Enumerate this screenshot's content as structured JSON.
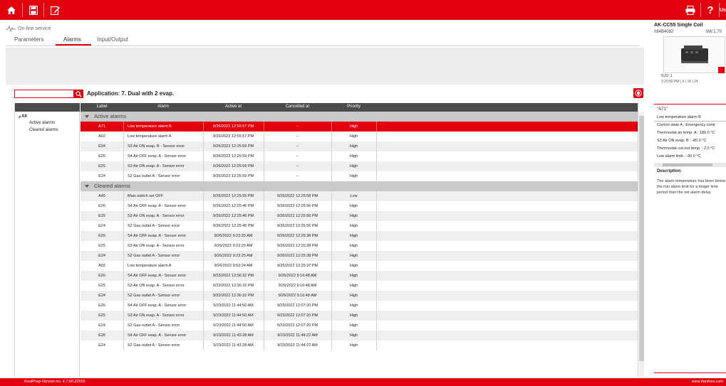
{
  "theme": {
    "accent": "#e2000f",
    "header_bg": "#4b4b4b",
    "group_bg": "#c9c9c9",
    "row_alt": "#efefef"
  },
  "toolbar": {
    "left_icons": [
      "home-icon",
      "save-icon",
      "edit-icon"
    ],
    "right_icons": [
      "print-icon",
      "help-icon"
    ],
    "user_label": "Us"
  },
  "service": {
    "label": "On-line service"
  },
  "tabs": [
    {
      "label": "Parameters",
      "active": false
    },
    {
      "label": "Alarms",
      "active": true
    },
    {
      "label": "Input/Output",
      "active": false
    }
  ],
  "search": {
    "value": "",
    "placeholder": ""
  },
  "application": {
    "label": "Application: 7. Dual with 2 evap."
  },
  "tree": {
    "root": "All",
    "children": [
      "Active alarms",
      "Cleared alarms"
    ]
  },
  "grid": {
    "columns": [
      "Label",
      "Alarm",
      "Active at",
      "Cancelled at",
      "Priority"
    ],
    "groups": [
      {
        "label": "Active alarms",
        "rows": [
          {
            "label": "A71",
            "alarm": "Low temperature alarm B",
            "active_at": "9/26/2022 12:55:57 PM",
            "cancelled_at": "--",
            "priority": "High",
            "selected": true
          },
          {
            "label": "A02",
            "alarm": "Low temperature alarm A",
            "active_at": "9/26/2022 12:55:57 PM",
            "cancelled_at": "--",
            "priority": "High",
            "selected": false
          },
          {
            "label": "E34",
            "alarm": "S3 Air ON evap. B - Sensor error",
            "active_at": "9/26/2022 12:25:59 PM",
            "cancelled_at": "--",
            "priority": "High",
            "selected": false
          },
          {
            "label": "E26",
            "alarm": "S4 Air OFF evap. A - Sensor error",
            "active_at": "9/26/2022 12:25:59 PM",
            "cancelled_at": "--",
            "priority": "High",
            "selected": false
          },
          {
            "label": "E25",
            "alarm": "S3 Air ON evap. A - Sensor error",
            "active_at": "9/26/2022 12:25:59 PM",
            "cancelled_at": "--",
            "priority": "High",
            "selected": false
          },
          {
            "label": "E24",
            "alarm": "S2 Gas outlet A - Sensor error",
            "active_at": "9/26/2022 12:25:59 PM",
            "cancelled_at": "--",
            "priority": "High",
            "selected": false
          }
        ]
      },
      {
        "label": "Cleared alarms",
        "rows": [
          {
            "label": "A45",
            "alarm": "Main switch set OFF",
            "active_at": "9/26/2022 12:25:55 PM",
            "cancelled_at": "9/26/2022 12:25:58 PM",
            "priority": "Low",
            "selected": false
          },
          {
            "label": "E26",
            "alarm": "S4 Air OFF evap. A - Sensor error",
            "active_at": "9/26/2022 12:25:46 PM",
            "cancelled_at": "9/26/2022 12:25:56 PM",
            "priority": "High",
            "selected": false
          },
          {
            "label": "E25",
            "alarm": "S3 Air ON evap. A - Sensor error",
            "active_at": "9/26/2022 12:25:46 PM",
            "cancelled_at": "9/26/2022 12:25:56 PM",
            "priority": "High",
            "selected": false
          },
          {
            "label": "E24",
            "alarm": "S2 Gas outlet A - Sensor error",
            "active_at": "9/26/2022 12:25:46 PM",
            "cancelled_at": "9/26/2022 12:25:56 PM",
            "priority": "High",
            "selected": false
          },
          {
            "label": "E26",
            "alarm": "S4 Air OFF evap. A - Sensor error",
            "active_at": "9/26/2022 9:23:25 AM",
            "cancelled_at": "9/26/2022 12:25:38 PM",
            "priority": "High",
            "selected": false
          },
          {
            "label": "E25",
            "alarm": "S3 Air ON evap. A - Sensor error",
            "active_at": "9/26/2022 9:23:25 AM",
            "cancelled_at": "9/26/2022 12:25:38 PM",
            "priority": "High",
            "selected": false
          },
          {
            "label": "E24",
            "alarm": "S2 Gas outlet A - Sensor error",
            "active_at": "9/26/2022 9:23:25 AM",
            "cancelled_at": "9/26/2022 12:25:38 PM",
            "priority": "High",
            "selected": false
          },
          {
            "label": "A02",
            "alarm": "Low temperature alarm A",
            "active_at": "9/26/2022 9:53:24 AM",
            "cancelled_at": "9/26/2022 12:25:37 PM",
            "priority": "High",
            "selected": false
          },
          {
            "label": "E26",
            "alarm": "S4 Air OFF evap. A - Sensor error",
            "active_at": "9/23/2022 12:36:32 PM",
            "cancelled_at": "9/26/2022 9:16:48 AM",
            "priority": "High",
            "selected": false
          },
          {
            "label": "E25",
            "alarm": "S3 Air ON evap. A - Sensor error",
            "active_at": "9/23/2022 12:36:32 PM",
            "cancelled_at": "9/26/2022 9:16:48 AM",
            "priority": "High",
            "selected": false
          },
          {
            "label": "E24",
            "alarm": "S2 Gas outlet A - Sensor error",
            "active_at": "9/23/2022 12:36:32 PM",
            "cancelled_at": "9/26/2022 9:16:48 AM",
            "priority": "High",
            "selected": false
          },
          {
            "label": "E26",
            "alarm": "S4 Air OFF evap. A - Sensor error",
            "active_at": "9/23/2022 11:44:50 AM",
            "cancelled_at": "9/23/2022 12:07:20 PM",
            "priority": "High",
            "selected": false
          },
          {
            "label": "E25",
            "alarm": "S3 Air ON evap. A - Sensor error",
            "active_at": "9/23/2022 11:44:50 AM",
            "cancelled_at": "9/23/2022 12:07:20 PM",
            "priority": "High",
            "selected": false
          },
          {
            "label": "E24",
            "alarm": "S2 Gas outlet A - Sensor error",
            "active_at": "9/23/2022 11:44:50 AM",
            "cancelled_at": "9/23/2022 12:07:20 PM",
            "priority": "High",
            "selected": false
          },
          {
            "label": "E26",
            "alarm": "S4 Air OFF evap. A - Sensor error",
            "active_at": "9/23/2022 11:43:28 AM",
            "cancelled_at": "9/23/2022 11:44:22 AM",
            "priority": "High",
            "selected": false
          },
          {
            "label": "E24",
            "alarm": "S2 Gas outlet A - Sensor error",
            "active_at": "9/23/2022 11:43:28 AM",
            "cancelled_at": "9/23/2022 11:44:22 AM",
            "priority": "High",
            "selected": false
          }
        ]
      }
    ]
  },
  "device": {
    "title": "AK-CC55 Single Coil",
    "code": "084B4082",
    "sw": "SW:1.70",
    "nid": "N.ID: 1",
    "time_info": "2:20:50 PM | 6 | 18 | 24"
  },
  "alarm_detail": {
    "code": "\"A71\"",
    "name": "Low temperature alarm B",
    "lines": [
      "Control state A : Emergency contr",
      "Thermostat air temp. A : 180.0 °C",
      "S3 Air ON evap. B : -80.0 °C",
      "Thermostat cut-out temp. : 2.0 °C",
      "Low alarm limit : -30.0 °C"
    ],
    "description_title": "Description:",
    "description": "The alarm temperature has been below the min alarm limit for a longer time period than the set alarm delay."
  },
  "footer": {
    "version": "KoolProg-Version no. 4.7.60.22655",
    "website": "www.danfoss.com"
  }
}
